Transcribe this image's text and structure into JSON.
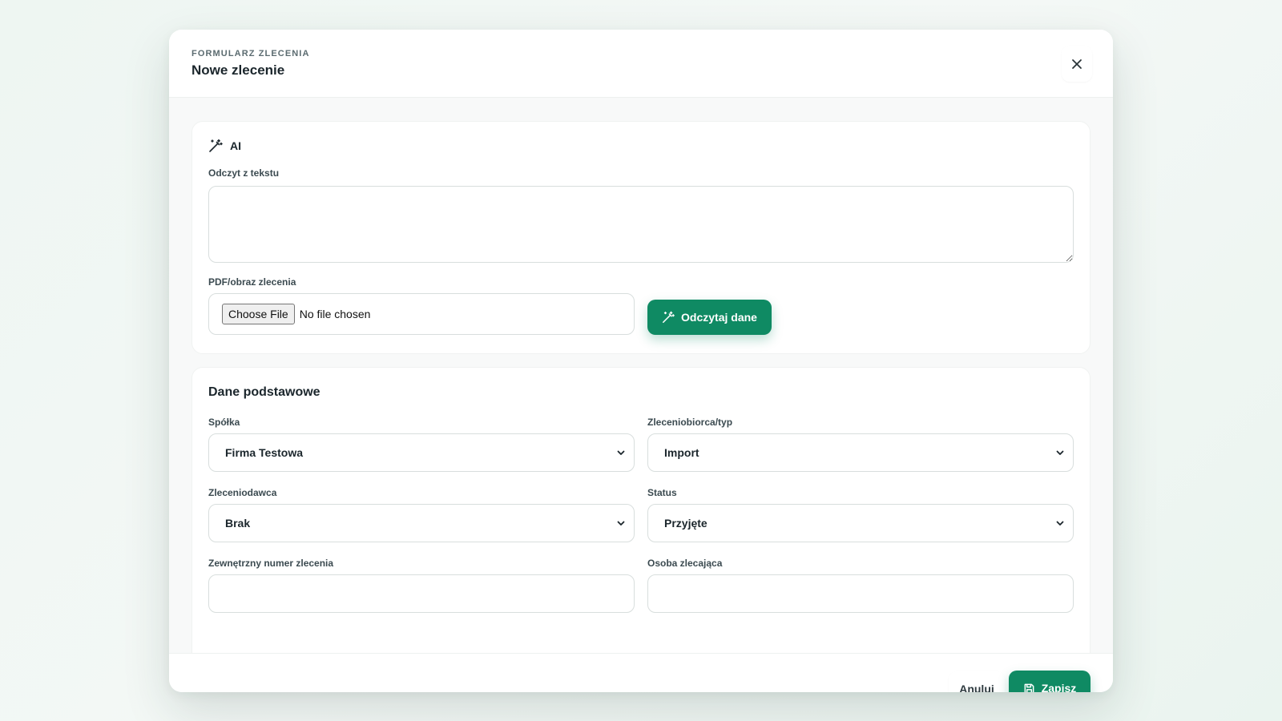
{
  "header": {
    "eyebrow": "FORMULARZ ZLECENIA",
    "title": "Nowe zlecenie"
  },
  "ai_section": {
    "heading": "AI",
    "text_label": "Odczyt z tekstu",
    "text_value": "",
    "file_label": "PDF/obraz zlecenia",
    "file_button": "Choose File",
    "file_status": "No file chosen",
    "read_button": "Odczytaj dane"
  },
  "basic_section": {
    "title": "Dane podstawowe",
    "fields": {
      "company": {
        "label": "Spółka",
        "value": "Firma Testowa"
      },
      "contractor_type": {
        "label": "Zleceniobiorca/typ",
        "value": "Import"
      },
      "client": {
        "label": "Zleceniodawca",
        "value": "Brak"
      },
      "status": {
        "label": "Status",
        "value": "Przyjęte"
      },
      "external_number": {
        "label": "Zewnętrzny numer zlecenia",
        "value": ""
      },
      "ordering_person": {
        "label": "Osoba zlecająca",
        "value": ""
      }
    }
  },
  "footer": {
    "cancel_label": "Anuluj",
    "save_label": "Zapisz"
  },
  "colors": {
    "accent": "#0f8a63",
    "background": "#eef6f2"
  }
}
